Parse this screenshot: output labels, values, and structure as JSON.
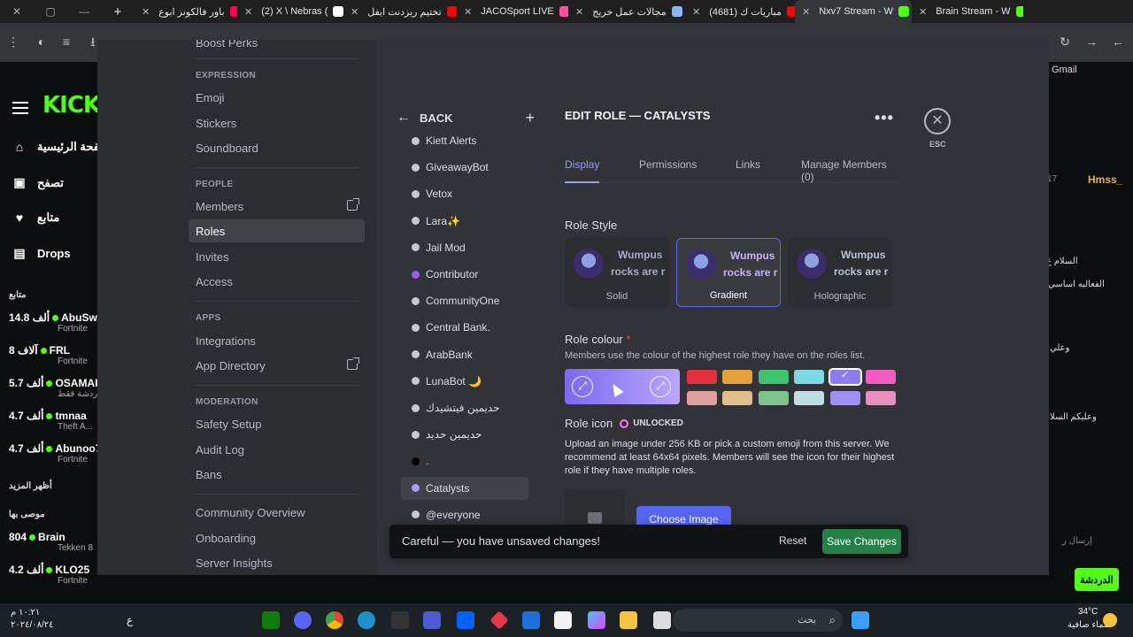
{
  "browser": {
    "tabs": [
      {
        "label": "باور فالكونز ابوع",
        "color": "#ff0050"
      },
      {
        "label": "(2) X \\ Nebras (",
        "color": "#ffffff"
      },
      {
        "label": "تختيم ريزدنت ايفل",
        "color": "#ff0000"
      },
      {
        "label": "JACOSport LIVE",
        "color": "#ff4fa0"
      },
      {
        "label": "مجالات عمل خريج",
        "color": "#8ab4f8"
      },
      {
        "label": "(4681) مباريات ك",
        "color": "#ff0000"
      },
      {
        "label": "Nxv7 Stream - W",
        "color": "#53fc18"
      },
      {
        "label": "Brain Stream - W",
        "color": "#53fc18"
      }
    ],
    "gmail_label": "Gmail"
  },
  "kick": {
    "logo": "KICK",
    "nav": [
      {
        "icon": "home-icon",
        "label": "الصفحة الرئيسية",
        "glyph": "⌂"
      },
      {
        "icon": "browse-icon",
        "label": "تصفح",
        "glyph": "▣"
      },
      {
        "icon": "heart-icon",
        "label": "متابع",
        "glyph": "♥"
      },
      {
        "icon": "drops-icon",
        "label": "Drops",
        "glyph": "▤"
      }
    ],
    "following_heading": "متابع",
    "show_more": "أظهر المزيد",
    "recommended_heading": "موصى بها",
    "streams": [
      {
        "name": "AbuSwe",
        "viewers": "14.8 ألف",
        "game": "Fortnite"
      },
      {
        "name": "FRL",
        "viewers": "8 آلاف",
        "game": "Fortnite"
      },
      {
        "name": "OSAMAH",
        "viewers": "5.7 ألف",
        "game": "الدردشة فقط"
      },
      {
        "name": "tmnaa",
        "viewers": "4.7 ألف",
        "game": "Theft A..."
      },
      {
        "name": "Abunoo7",
        "viewers": "4.7 ألف",
        "game": "Fortnite"
      }
    ],
    "recommended": [
      {
        "name": "Brain",
        "viewers": "804",
        "game": "Tekken 8"
      },
      {
        "name": "KLO25",
        "viewers": "4.2 ألف",
        "game": "Fortnite"
      }
    ],
    "chat_user": "Hmss_",
    "chat_count": "17",
    "chat_button": "الدردشة",
    "chat_lines": [
      "السلام ع",
      "الفعاليه اساسي",
      "وعلي",
      "وعليكم السلا"
    ],
    "chat_placeholder": "إرسال ر"
  },
  "discord": {
    "sidebar": {
      "top_cut": "Boost Perks",
      "sections": [
        {
          "title": "EXPRESSION",
          "items": [
            "Emoji",
            "Stickers",
            "Soundboard"
          ]
        },
        {
          "title": "PEOPLE",
          "items": [
            "Members",
            "Roles",
            "Invites",
            "Access"
          ]
        },
        {
          "title": "APPS",
          "items": [
            "Integrations",
            "App Directory"
          ]
        },
        {
          "title": "MODERATION",
          "items": [
            "Safety Setup",
            "Audit Log",
            "Bans"
          ]
        }
      ],
      "bottom_items": [
        "Community Overview",
        "Onboarding",
        "Server Insights"
      ]
    },
    "roles": {
      "back_label": "BACK",
      "items": [
        {
          "name": "Kiett Alerts",
          "color": "#c4c9ce"
        },
        {
          "name": "GiveawayBot",
          "color": "#c4c9ce"
        },
        {
          "name": "Vetox",
          "color": "#c4c9ce"
        },
        {
          "name": "Lara✨",
          "color": "#c4c9ce"
        },
        {
          "name": "Jail Mod",
          "color": "#c4c9ce"
        },
        {
          "name": "Contributor",
          "color": "#9b59ff"
        },
        {
          "name": "CommunityOne",
          "color": "#c4c9ce"
        },
        {
          "name": "Central Bank.",
          "color": "#c4c9ce"
        },
        {
          "name": "ArabBank",
          "color": "#c4c9ce"
        },
        {
          "name": "LunaBot 🌙",
          "color": "#c4c9ce"
        },
        {
          "name": "حديمين فيتشيدك",
          "color": "#c4c9ce"
        },
        {
          "name": "حديمين حديد",
          "color": "#c4c9ce"
        },
        {
          "name": ".",
          "color": "#000000"
        },
        {
          "name": "Catalysts",
          "color": "#a89cf7"
        },
        {
          "name": "@everyone",
          "color": "#c4c9ce"
        }
      ]
    },
    "edit": {
      "title": "EDIT ROLE — CATALYSTS",
      "esc_label": "ESC",
      "tabs": [
        "Display",
        "Permissions",
        "Links",
        "Manage Members (0)"
      ],
      "role_style_heading": "Role Style",
      "styles": [
        {
          "name": "Solid",
          "preview_line1": "Wumpus",
          "preview_line2": "rocks are r"
        },
        {
          "name": "Gradient",
          "preview_line1": "Wumpus",
          "preview_line2": "rocks are r"
        },
        {
          "name": "Holographic",
          "preview_line1": "Wumpus",
          "preview_line2": "rocks are r"
        }
      ],
      "role_colour_heading": "Role colour",
      "required_mark": "*",
      "role_colour_desc": "Members use the colour of the highest role they have on the roles list.",
      "swatches_top": [
        "#e0323c",
        "#e6a13a",
        "#3ec46d",
        "#7cd8e6",
        "#8b7cf0",
        "#f05cc2"
      ],
      "swatches_bottom": [
        "#e0a09f",
        "#e0c08a",
        "#7fc48e",
        "#c3dde4",
        "#9f8ff0",
        "#e88fbc"
      ],
      "role_icon_heading": "Role icon",
      "unlocked_label": "UNLOCKED",
      "role_icon_desc": "Upload an image under 256 KB or pick a custom emoji from this server. We recommend at least 64x64 pixels. Members will see the icon for their highest role if they have multiple roles.",
      "choose_image": "Choose Image"
    },
    "unsaved": {
      "message": "Careful — you have unsaved changes!",
      "reset": "Reset",
      "save": "Save Changes"
    }
  },
  "taskbar": {
    "time": "١٠:٢١ م",
    "date": "٢٠٢٤/٠٨/٢٤",
    "lang": "ع",
    "search": "بحث",
    "weather_temp": "34°C",
    "weather_desc": "سماء صافية"
  }
}
